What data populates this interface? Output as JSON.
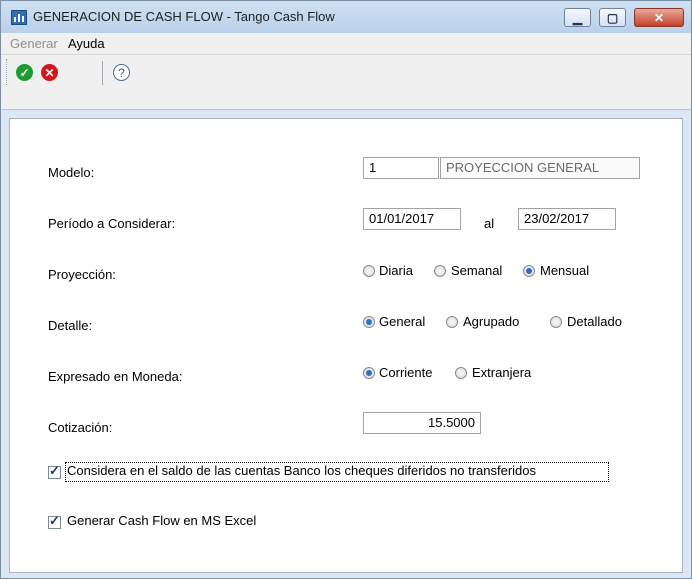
{
  "window": {
    "title": "GENERACION DE CASH FLOW - Tango Cash Flow",
    "minimize_glyph": "▁",
    "maximize_glyph": "▢",
    "close_glyph": "✕"
  },
  "menu": {
    "generar": "Generar",
    "ayuda": "Ayuda"
  },
  "toolbar": {
    "ok_glyph": "✓",
    "cancel_glyph": "✕",
    "help_glyph": "?"
  },
  "form": {
    "modelo_label": "Modelo:",
    "modelo_code": "1",
    "modelo_name": "PROYECCION GENERAL",
    "periodo_label": "Período a Considerar:",
    "periodo_desde": "01/01/2017",
    "periodo_al": "al",
    "periodo_hasta": "23/02/2017",
    "proyeccion_label": "Proyección:",
    "proyeccion_options": [
      "Diaria",
      "Semanal",
      "Mensual"
    ],
    "proyeccion_selected": "Mensual",
    "detalle_label": "Detalle:",
    "detalle_options": [
      "General",
      "Agrupado",
      "Detallado"
    ],
    "detalle_selected": "General",
    "moneda_label": "Expresado en Moneda:",
    "moneda_options": [
      "Corriente",
      "Extranjera"
    ],
    "moneda_selected": "Corriente",
    "cotizacion_label": "Cotización:",
    "cotizacion_value": "15.5000",
    "cheques_label": "Considera en el saldo de las cuentas Banco los cheques diferidos no transferidos",
    "cheques_checked": true,
    "excel_label": "Generar Cash Flow en MS Excel",
    "excel_checked": true
  },
  "colors": {
    "title_bar": "#c4d8ee",
    "ok_icon": "#1d9d31",
    "cancel_icon": "#d7141a",
    "radio_selected": "#2a6fc9"
  }
}
